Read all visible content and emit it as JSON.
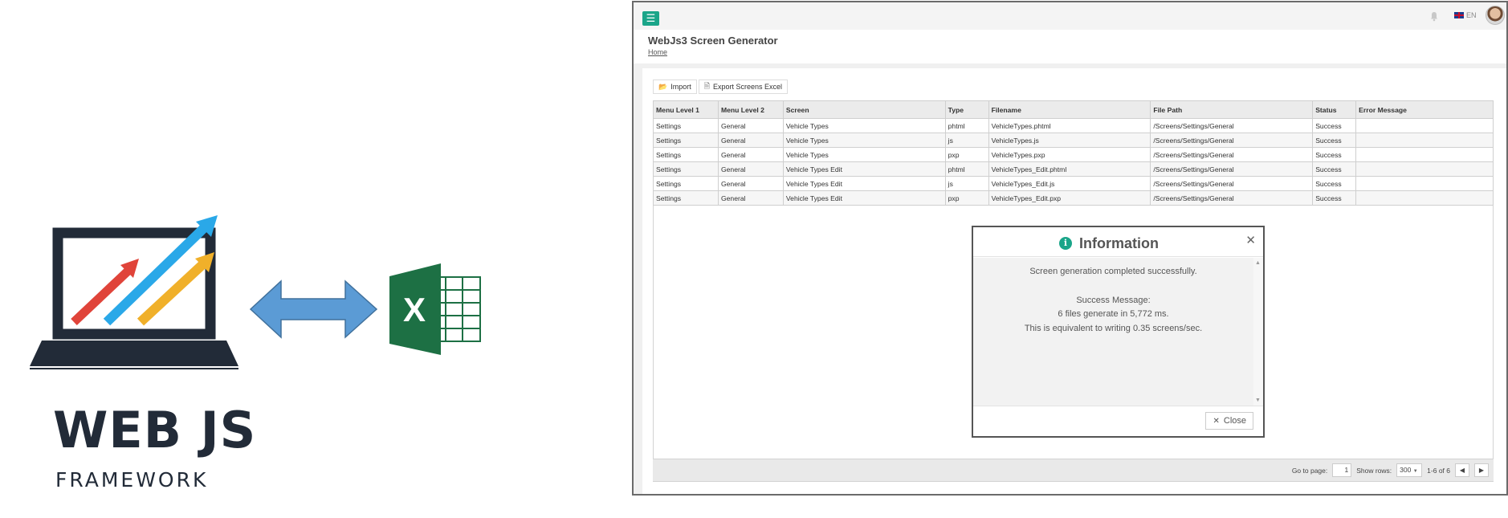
{
  "promo": {
    "title": "WEB JS",
    "subtitle": "FRAMEWORK"
  },
  "app": {
    "title": "WebJs3 Screen Generator",
    "breadcrumb": "Home",
    "language": "EN",
    "accent_color": "#1aa589",
    "toolbar": {
      "import_label": "Import",
      "export_label": "Export Screens Excel"
    },
    "table": {
      "columns": [
        "Menu Level 1",
        "Menu Level 2",
        "Screen",
        "Type",
        "Filename",
        "File Path",
        "Status",
        "Error Message"
      ],
      "rows": [
        [
          "Settings",
          "General",
          "Vehicle Types",
          "phtml",
          "VehicleTypes.phtml",
          "/Screens/Settings/General",
          "Success",
          ""
        ],
        [
          "Settings",
          "General",
          "Vehicle Types",
          "js",
          "VehicleTypes.js",
          "/Screens/Settings/General",
          "Success",
          ""
        ],
        [
          "Settings",
          "General",
          "Vehicle Types",
          "pxp",
          "VehicleTypes.pxp",
          "/Screens/Settings/General",
          "Success",
          ""
        ],
        [
          "Settings",
          "General",
          "Vehicle Types Edit",
          "phtml",
          "VehicleTypes_Edit.phtml",
          "/Screens/Settings/General",
          "Success",
          ""
        ],
        [
          "Settings",
          "General",
          "Vehicle Types Edit",
          "js",
          "VehicleTypes_Edit.js",
          "/Screens/Settings/General",
          "Success",
          ""
        ],
        [
          "Settings",
          "General",
          "Vehicle Types Edit",
          "pxp",
          "VehicleTypes_Edit.pxp",
          "/Screens/Settings/General",
          "Success",
          ""
        ]
      ]
    },
    "footer": {
      "goto_label": "Go to page:",
      "page_value": "1",
      "rows_label": "Show rows:",
      "rows_value": "300",
      "range_text": "1-6 of 6"
    },
    "modal": {
      "title": "Information",
      "line1": "Screen generation completed successfully.",
      "line2": "Success Message:",
      "line3": "6 files generate in 5,772 ms.",
      "line4": "This is equivalent to writing 0.35 screens/sec.",
      "close_label": "Close"
    }
  }
}
